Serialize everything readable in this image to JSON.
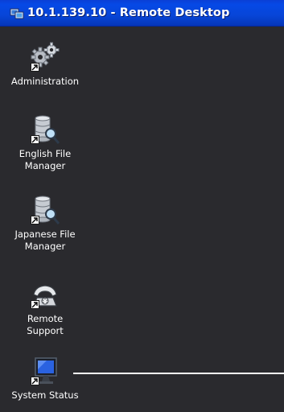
{
  "window": {
    "title": "10.1.139.10 - Remote Desktop",
    "titlebar_color": "#0649e6",
    "desktop_color": "#2a2a2e"
  },
  "desktop": {
    "icons": [
      {
        "label": "Administration",
        "icon": "gears-icon"
      },
      {
        "label": "English File\nManager",
        "icon": "database-search-icon"
      },
      {
        "label": "Japanese File\nManager",
        "icon": "database-search-icon"
      },
      {
        "label": "Remote\nSupport",
        "icon": "telephone-icon"
      },
      {
        "label": "System Status",
        "icon": "monitor-icon"
      }
    ]
  }
}
